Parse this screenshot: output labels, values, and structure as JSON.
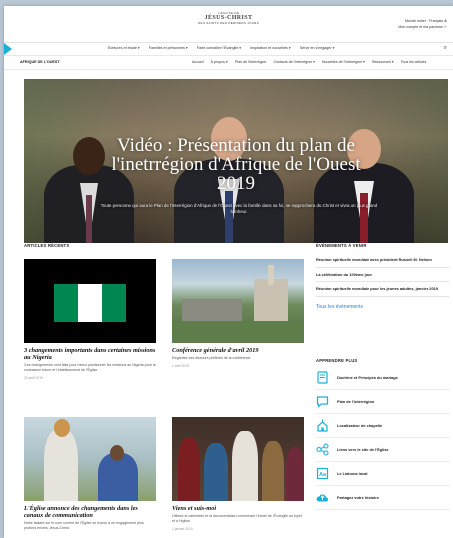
{
  "colors": {
    "accent": "#1ab0d6",
    "link": "#3a7fbf",
    "nigeria_green": "#008751"
  },
  "header": {
    "logo": {
      "line1": "L'ÉGLISE DE",
      "line2": "JÉSUS-CHRIST",
      "line3": "DES SAINTS DES DERNIERS JOURS"
    },
    "utility": {
      "line1": "Monde entier · Français ⊕",
      "line2": "Mon compte et ma paroisse ⚇"
    }
  },
  "main_nav": {
    "items": [
      "Écritures et étude ▾",
      "Familles et personnes ▾",
      "Faire connaître l'Évangile ▾",
      "Inspiration et nouvelles ▾",
      "Servir en s'engager ▾"
    ],
    "search_icon": "⌕"
  },
  "sub_nav": {
    "region": "AFRIQUE DE L'OUEST",
    "items": [
      "Accueil",
      "À propos ▾",
      "Plan de l'interrégion",
      "Contacts de l'interrégion ▾",
      "Nouvelles de l'interrégion ▾",
      "Ressources ▾",
      "Tous les articles"
    ]
  },
  "hero": {
    "title_line1": "Vidéo : Présentation du plan de",
    "title_line2": "l'inetrrégion d'Afrique de l'Ouest",
    "title_line3": "2019",
    "caption": "Toute personne qui aura le Plan de l'interrégion d'Afrique de l'Ouest avec la famille dans sa foi, se rapprochera du Christ et vivra un plus grand bonheur."
  },
  "articles": {
    "heading": "ARTICLES RÉCENTS",
    "items": [
      {
        "title": "3 changements importants dans certaines missions au Nigeria",
        "desc": "Ces changements sont faits pour mieux positionner les missions au Nigeria pour la croissance future et l'établissement de l'Église.",
        "date": "23 avril 2019"
      },
      {
        "title": "Conférence générale d'avril 2019",
        "desc": "Regardez ces discours préférés de la conférence.",
        "date": "1 avril 2019"
      },
      {
        "title": "L'Église annonce des changements dans les canaux de communication",
        "desc": "Notre faisant sur le nom correct de l'Église se trouve à un engagement plus profond envers Jésus-Christ.",
        "date": ""
      },
      {
        "title": "Viens et suis-moi",
        "desc": "Utilisez le calendrier et la documentation concernant l'étude de l'Évangile au foyer et à l'église.",
        "date": "1 janvier 2019"
      }
    ]
  },
  "events": {
    "heading": "ÉVÉNEMENTS À VENIR",
    "items": [
      "Réunion spirituelle mondiale avec président Russell M. Nelson",
      "La célébration du 100ème jour",
      "Réunion spirituelle mondiale pour les jeunes adultes, janvier 2019"
    ],
    "all_link": "Tous les événements"
  },
  "learn_more": {
    "heading": "APPRENDRE PLUS",
    "items": [
      {
        "label": "Doctrine et Principes du mariage",
        "icon": "book-icon"
      },
      {
        "label": "Plan de l'interrégion",
        "icon": "speech-bubble-icon"
      },
      {
        "label": "Localisateur de chapelle",
        "icon": "chapel-icon"
      },
      {
        "label": "Liens vers le site de l'Église",
        "icon": "share-links-icon"
      },
      {
        "label": "Le Liahona local",
        "icon": "magazine-icon"
      },
      {
        "label": "Partagez votre histoire",
        "icon": "cloud-upload-icon"
      }
    ]
  }
}
